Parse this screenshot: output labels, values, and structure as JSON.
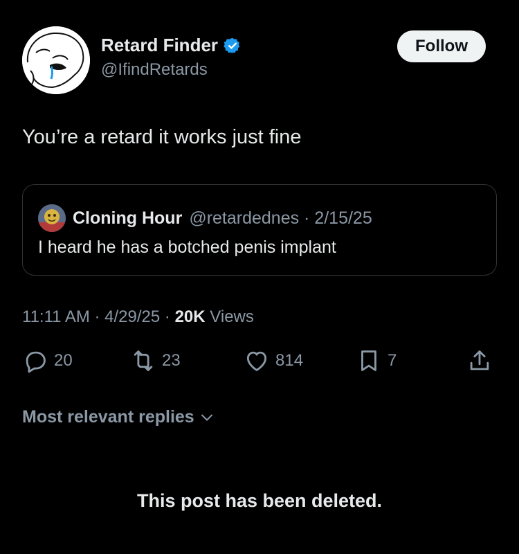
{
  "author": {
    "display_name": "Retard Finder",
    "handle": "@IfindRetards",
    "verified_icon": "verified-badge-icon",
    "avatar_icon": "wojak-avatar"
  },
  "follow_label": "Follow",
  "tweet": {
    "text": "You’re a retard it works just fine"
  },
  "quote": {
    "author_name": "Cloning Hour",
    "meta": "@retardednes · 2/15/25",
    "text": "I heard he has a botched penis implant"
  },
  "meta": {
    "time": "11:11 AM · 4/29/25 · ",
    "views_count": "20K",
    "views_label": "Views"
  },
  "actions": {
    "replies": "20",
    "reposts": "23",
    "likes": "814",
    "bookmarks": "7"
  },
  "replies_sort_label": "Most relevant replies",
  "deleted_notice": "This post has been deleted.",
  "colors": {
    "background": "#000000",
    "text": "#e7e9ea",
    "muted": "#8b98a5",
    "verified": "#1d9bf0",
    "border": "#2f3336"
  }
}
